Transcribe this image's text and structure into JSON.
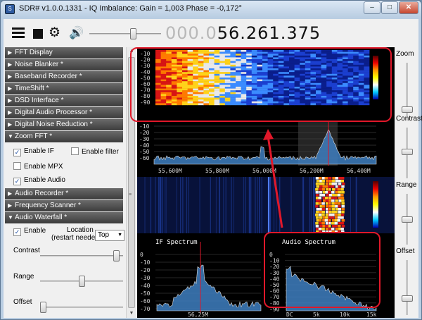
{
  "window": {
    "title": "SDR# v1.0.0.1331 - IQ Imbalance: Gain = 1,003 Phase = -0,172°",
    "min_glyph": "–",
    "max_glyph": "□",
    "close_glyph": "✕"
  },
  "toolbar": {
    "frequency_dim": "000.0",
    "frequency_main": "56.261.375",
    "volume_level": 0.62
  },
  "sidebar": {
    "panels": [
      {
        "label": "FFT Display",
        "expanded": false
      },
      {
        "label": "Noise Blanker *",
        "expanded": false
      },
      {
        "label": "Baseband Recorder *",
        "expanded": false
      },
      {
        "label": "TimeShift *",
        "expanded": false
      },
      {
        "label": "DSD Interface *",
        "expanded": false
      },
      {
        "label": "Digital Audio Processor *",
        "expanded": false
      },
      {
        "label": "Digital Noise Reduction *",
        "expanded": false
      },
      {
        "label": "Zoom FFT *",
        "expanded": true
      },
      {
        "label": "Audio Recorder *",
        "expanded": false
      },
      {
        "label": "Frequency Scanner *",
        "expanded": false
      },
      {
        "label": "Audio Waterfall *",
        "expanded": true
      }
    ],
    "zoom_fft": {
      "enable_if": {
        "label": "Enable IF",
        "checked": true
      },
      "enable_filter": {
        "label": "Enable filter",
        "checked": false
      },
      "enable_mpx": {
        "label": "Enable MPX",
        "checked": false
      },
      "enable_audio": {
        "label": "Enable Audio",
        "checked": true
      }
    },
    "audio_waterfall": {
      "enable": {
        "label": "Enable",
        "checked": true
      },
      "location_label_1": "Location",
      "location_label_2": "(restart needed)",
      "location_value": "Top",
      "contrast_label": "Contrast",
      "range_label": "Range",
      "offset_label": "Offset",
      "contrast_level": 0.95,
      "range_level": 0.5,
      "offset_level": 0.0
    }
  },
  "right_controls": {
    "zoom_label": "Zoom",
    "contrast_label": "Contrast",
    "range_label": "Range",
    "offset_label": "Offset"
  },
  "spectrum": {
    "y_ticks": [
      "-10",
      "-20",
      "-30",
      "-40",
      "-50",
      "-60"
    ],
    "x_ticks": [
      "55,600M",
      "55,800M",
      "56,000M",
      "56,200M",
      "56,400M"
    ]
  },
  "audio_waterfall_panel": {
    "y_ticks": [
      "-10",
      "-20",
      "-30",
      "-40",
      "-50",
      "-60",
      "-70",
      "-80",
      "-90"
    ]
  },
  "if_spectrum": {
    "title": "IF Spectrum",
    "y_ticks": [
      "0",
      "-10",
      "-20",
      "-30",
      "-40",
      "-50",
      "-60",
      "-70"
    ],
    "x_tick": "56,25M"
  },
  "audio_spectrum": {
    "title": "Audio Spectrum",
    "y_ticks": [
      "0",
      "-10",
      "-20",
      "-30",
      "-40",
      "-50",
      "-60",
      "-70",
      "-80",
      "-90"
    ],
    "x_ticks": [
      "DC",
      "5k",
      "10k",
      "15k"
    ]
  },
  "colors": {
    "highlight": "#e0182a",
    "spectrum_fill": "#3f7fc1",
    "spectrum_line": "#ffffff"
  }
}
